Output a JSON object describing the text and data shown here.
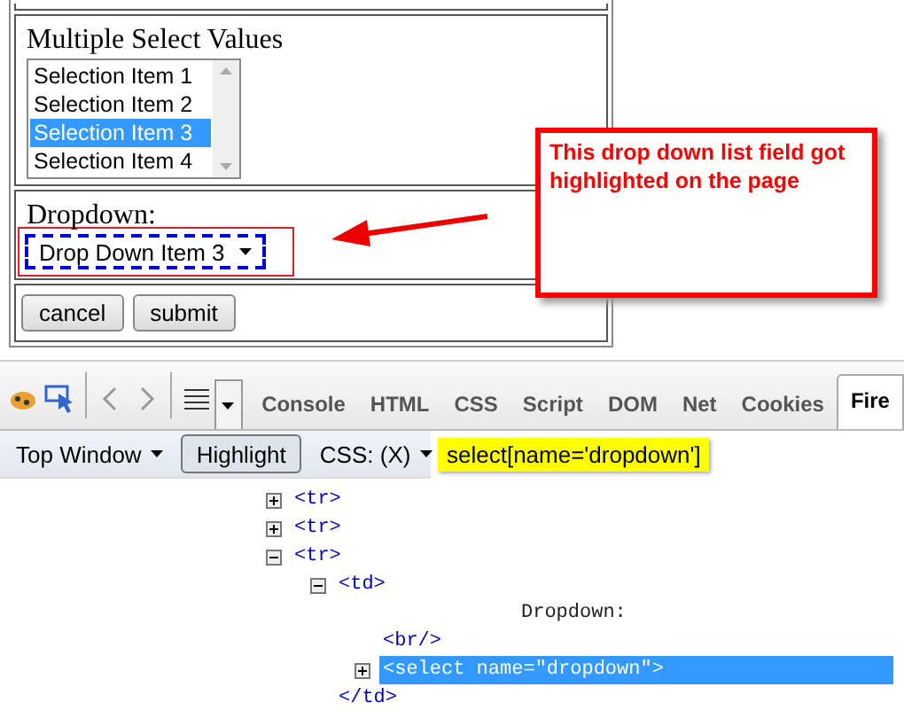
{
  "form": {
    "multi_select": {
      "label": "Multiple Select Values",
      "options": [
        {
          "label": "Selection Item 1",
          "selected": false
        },
        {
          "label": "Selection Item 2",
          "selected": false
        },
        {
          "label": "Selection Item 3",
          "selected": true
        },
        {
          "label": "Selection Item 4",
          "selected": false
        }
      ]
    },
    "dropdown": {
      "label": "Dropdown:",
      "value": "Drop Down Item 3",
      "highlighted": true
    },
    "buttons": [
      "cancel",
      "submit"
    ]
  },
  "callout": {
    "text": "This drop down list field got highlighted on the page"
  },
  "devtools": {
    "tabs": [
      {
        "label": "Console",
        "selected": false
      },
      {
        "label": "HTML",
        "selected": false
      },
      {
        "label": "CSS",
        "selected": false
      },
      {
        "label": "Script",
        "selected": false
      },
      {
        "label": "DOM",
        "selected": false
      },
      {
        "label": "Net",
        "selected": false
      },
      {
        "label": "Cookies",
        "selected": false
      },
      {
        "label": "Fire",
        "selected": true
      }
    ],
    "context": "Top Window",
    "highlight_button": "Highlight",
    "highlight_on": true,
    "css_label": "CSS: (X)",
    "selector": "select[name='dropdown']",
    "tree": [
      {
        "kind": "element",
        "text": "<tr>",
        "expanded": false,
        "selected": false
      },
      {
        "kind": "element",
        "text": "<tr>",
        "expanded": false,
        "selected": false
      },
      {
        "kind": "element",
        "text": "<tr>",
        "expanded": true,
        "selected": false,
        "children": [
          {
            "kind": "element",
            "text": "<td>",
            "expanded": true,
            "selected": false,
            "closing": "</td>",
            "children": [
              {
                "kind": "text",
                "text": "Dropdown:"
              },
              {
                "kind": "leaf",
                "text": "<br/>",
                "selected": false
              },
              {
                "kind": "element",
                "text": "<select name=\"dropdown\">",
                "expanded": false,
                "selected": true
              }
            ]
          }
        ]
      }
    ]
  }
}
